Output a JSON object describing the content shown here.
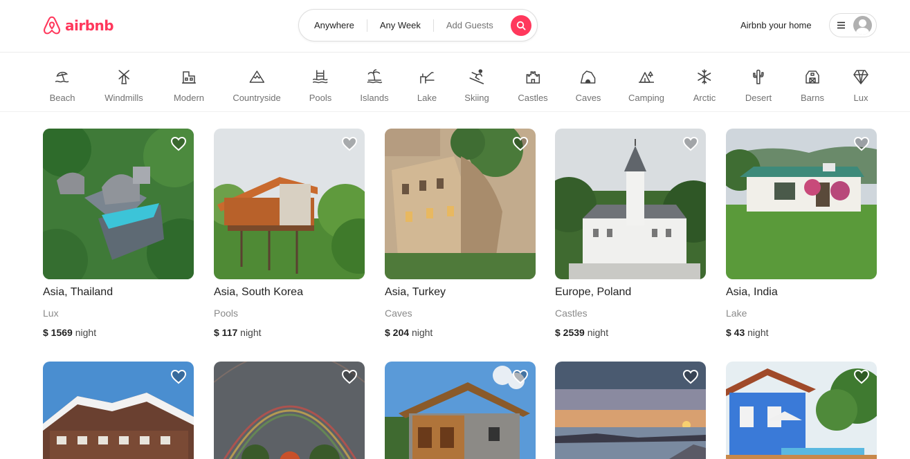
{
  "brand": {
    "name": "airbnb",
    "color": "#ff385c"
  },
  "search": {
    "location": "Anywhere",
    "week": "Any Week",
    "guests": "Add Guests",
    "button_icon": "search-icon"
  },
  "header": {
    "host_link": "Airbnb your home",
    "menu_icon": "hamburger-icon",
    "avatar_icon": "user-avatar-icon"
  },
  "categories": [
    {
      "label": "Beach",
      "icon": "beach-icon"
    },
    {
      "label": "Windmills",
      "icon": "windmill-icon"
    },
    {
      "label": "Modern",
      "icon": "modern-house-icon"
    },
    {
      "label": "Countryside",
      "icon": "mountain-icon"
    },
    {
      "label": "Pools",
      "icon": "pool-icon"
    },
    {
      "label": "Islands",
      "icon": "island-icon"
    },
    {
      "label": "Lake",
      "icon": "lake-icon"
    },
    {
      "label": "Skiing",
      "icon": "skiing-icon"
    },
    {
      "label": "Castles",
      "icon": "castle-icon"
    },
    {
      "label": "Caves",
      "icon": "cave-icon"
    },
    {
      "label": "Camping",
      "icon": "camping-icon"
    },
    {
      "label": "Arctic",
      "icon": "snowflake-icon"
    },
    {
      "label": "Desert",
      "icon": "cactus-icon"
    },
    {
      "label": "Barns",
      "icon": "barn-icon"
    },
    {
      "label": "Lux",
      "icon": "diamond-icon"
    }
  ],
  "listings": [
    {
      "location": "Asia, Thailand",
      "category": "Lux",
      "price": "$ 1569",
      "unit": "night"
    },
    {
      "location": "Asia, South Korea",
      "category": "Pools",
      "price": "$ 117",
      "unit": "night"
    },
    {
      "location": "Asia, Turkey",
      "category": "Caves",
      "price": "$ 204",
      "unit": "night"
    },
    {
      "location": "Europe, Poland",
      "category": "Castles",
      "price": "$ 2539",
      "unit": "night"
    },
    {
      "location": "Asia, India",
      "category": "Lake",
      "price": "$ 43",
      "unit": "night"
    }
  ]
}
